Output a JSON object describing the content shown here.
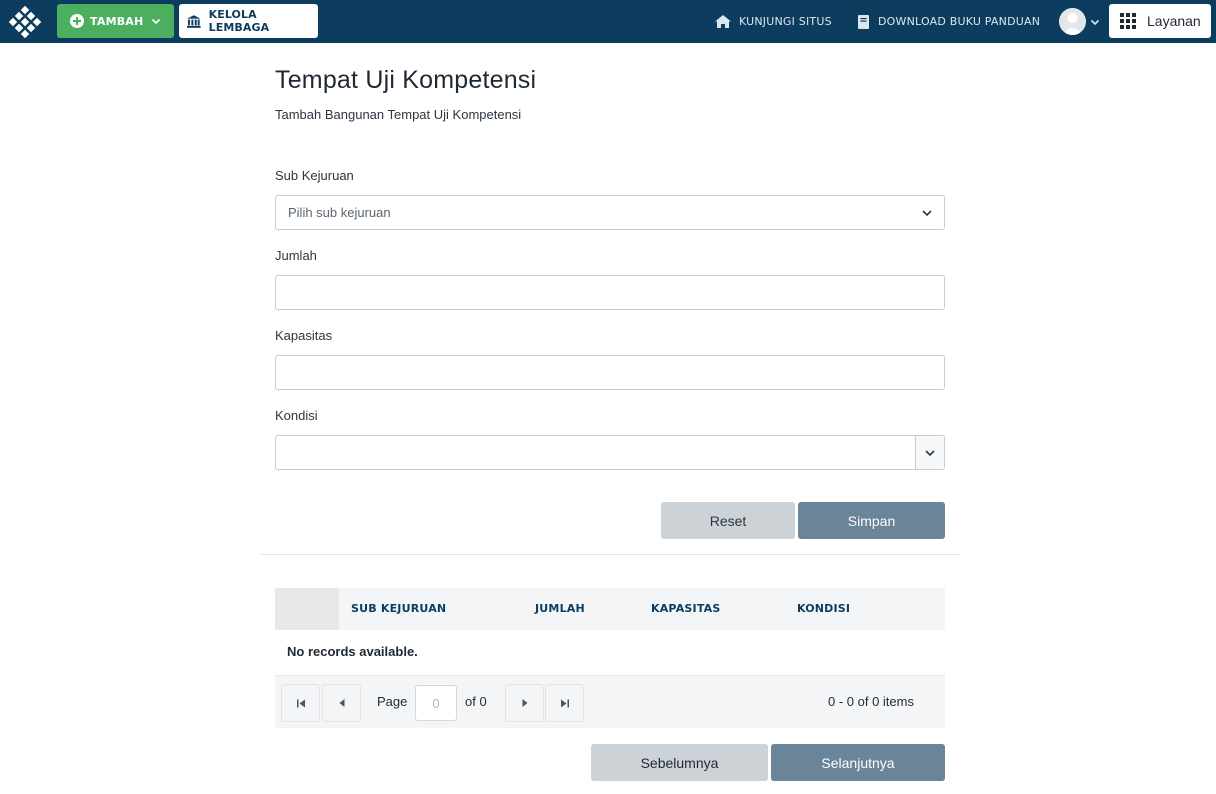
{
  "topbar": {
    "tambah_label": "TAMBAH",
    "kelola_label": "KELOLA LEMBAGA",
    "kunjungi_label": "KUNJUNGI SITUS",
    "download_label": "DOWNLOAD BUKU PANDUAN",
    "layanan_label": "Layanan",
    "icons": [
      "logo-icon",
      "plus-circle-icon",
      "chevron-down-icon",
      "bank-icon",
      "home-icon",
      "book-icon",
      "user-avatar",
      "grid-apps-icon"
    ]
  },
  "header": {
    "title": "Tempat Uji Kompetensi",
    "subtitle": "Tambah Bangunan Tempat Uji Kompetensi"
  },
  "form": {
    "sub_kejuruan_label": "Sub Kejuruan",
    "sub_kejuruan_placeholder": "Pilih sub kejuruan",
    "jumlah_label": "Jumlah",
    "jumlah_value": "",
    "kapasitas_label": "Kapasitas",
    "kapasitas_value": "",
    "kondisi_label": "Kondisi",
    "kondisi_value": "",
    "reset_label": "Reset",
    "simpan_label": "Simpan"
  },
  "grid": {
    "columns": [
      "SUB KEJURUAN",
      "JUMLAH",
      "KAPASITAS",
      "KONDISI"
    ],
    "no_records": "No records available.",
    "pager": {
      "page_label": "Page",
      "page_value": "0",
      "of_label": "of 0",
      "items_label": "0 - 0 of 0 items"
    }
  },
  "wizard": {
    "prev_label": "Sebelumnya",
    "next_label": "Selanjutnya"
  },
  "colors": {
    "topbar": "#0c3c5e",
    "tambah": "#4caf60",
    "primary_button": "#6a8499",
    "secondary_button": "#cdd2d7"
  }
}
